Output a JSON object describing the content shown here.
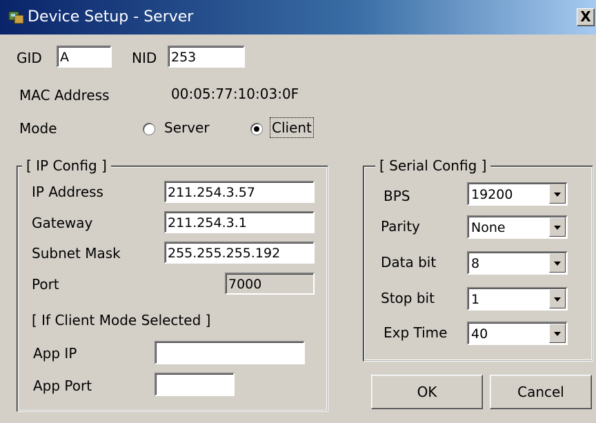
{
  "window": {
    "title": "Device Setup - Server",
    "close_label": "X"
  },
  "ids": {
    "gid_label": "GID",
    "gid_value": "A",
    "nid_label": "NID",
    "nid_value": "253"
  },
  "mac": {
    "label": "MAC Address",
    "value": "00:05:77:10:03:0F"
  },
  "mode": {
    "label": "Mode",
    "options": [
      {
        "label": "Server",
        "selected": false
      },
      {
        "label": "Client",
        "selected": true
      }
    ]
  },
  "ip_config": {
    "title": "[ IP Config ]",
    "ip_address": {
      "label": "IP Address",
      "value": "211.254.3.57"
    },
    "gateway": {
      "label": "Gateway",
      "value": "211.254.3.1"
    },
    "subnet_mask": {
      "label": "Subnet Mask",
      "value": "255.255.255.192"
    },
    "port": {
      "label": "Port",
      "value": "7000"
    },
    "client_section": "[ If Client Mode Selected ]",
    "app_ip": {
      "label": "App IP",
      "value": ""
    },
    "app_port": {
      "label": "App Port",
      "value": ""
    }
  },
  "serial_config": {
    "title": "[ Serial Config ]",
    "bps": {
      "label": "BPS",
      "value": "19200"
    },
    "parity": {
      "label": "Parity",
      "value": "None"
    },
    "data_bit": {
      "label": "Data bit",
      "value": "8"
    },
    "stop_bit": {
      "label": "Stop bit",
      "value": "1"
    },
    "exp_time": {
      "label": "Exp Time",
      "value": "40"
    }
  },
  "buttons": {
    "ok": "OK",
    "cancel": "Cancel"
  }
}
